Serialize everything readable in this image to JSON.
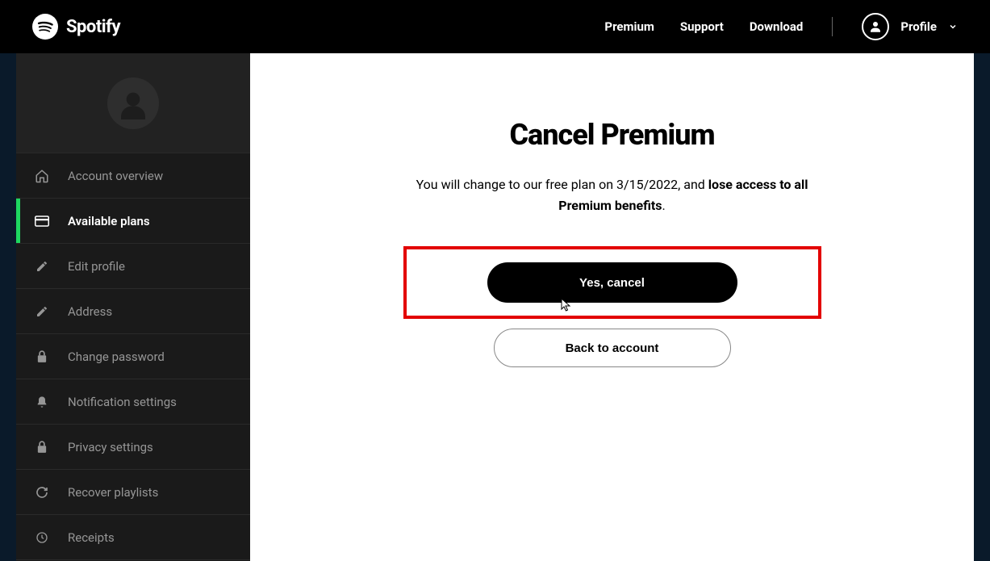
{
  "header": {
    "brand": "Spotify",
    "nav": {
      "premium": "Premium",
      "support": "Support",
      "download": "Download"
    },
    "profile_label": "Profile"
  },
  "sidebar": {
    "items": [
      {
        "label": "Account overview",
        "icon": "home-icon"
      },
      {
        "label": "Available plans",
        "icon": "card-icon"
      },
      {
        "label": "Edit profile",
        "icon": "pencil-icon"
      },
      {
        "label": "Address",
        "icon": "pencil-icon"
      },
      {
        "label": "Change password",
        "icon": "lock-icon"
      },
      {
        "label": "Notification settings",
        "icon": "bell-icon"
      },
      {
        "label": "Privacy settings",
        "icon": "lock-icon"
      },
      {
        "label": "Recover playlists",
        "icon": "refresh-icon"
      },
      {
        "label": "Receipts",
        "icon": "clock-icon"
      }
    ],
    "active_index": 1
  },
  "main": {
    "title": "Cancel Premium",
    "desc_pre": "You will change to our free plan on 3/15/2022, and ",
    "desc_bold": "lose access to all Premium benefits",
    "desc_post": ".",
    "button_primary": "Yes, cancel",
    "button_secondary": "Back to account"
  }
}
